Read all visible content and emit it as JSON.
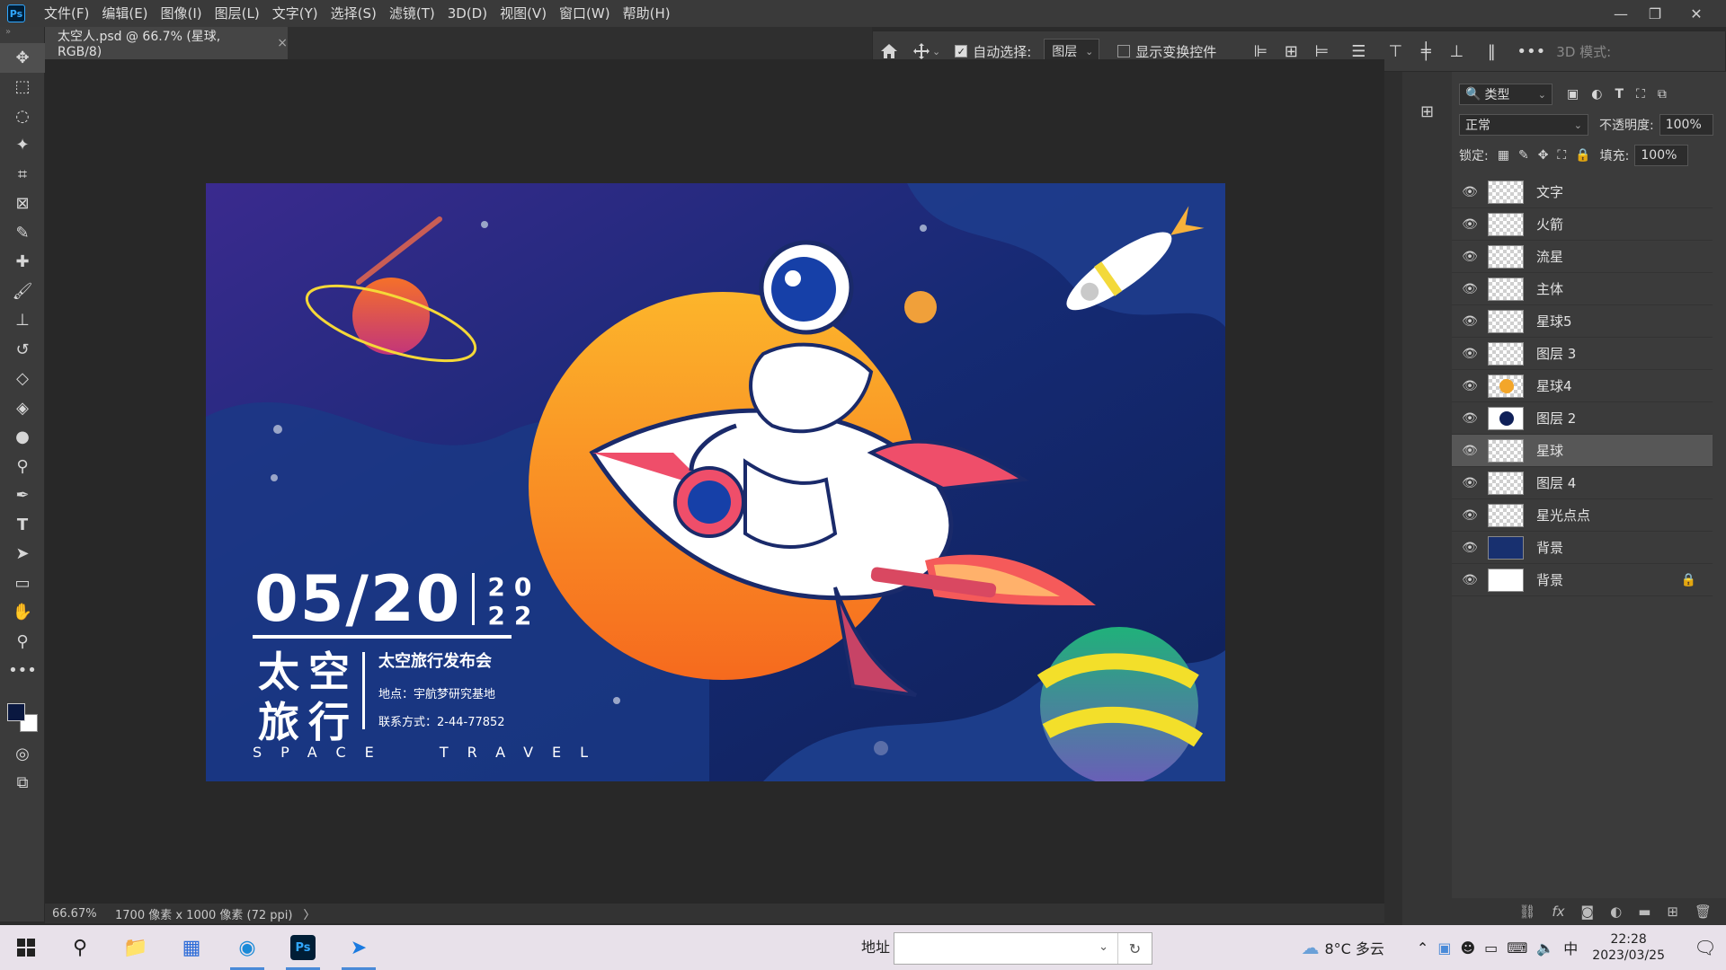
{
  "app": {
    "logo": "Ps"
  },
  "menu": [
    "文件(F)",
    "编辑(E)",
    "图像(I)",
    "图层(L)",
    "文字(Y)",
    "选择(S)",
    "滤镜(T)",
    "3D(D)",
    "视图(V)",
    "窗口(W)",
    "帮助(H)"
  ],
  "window_controls": {
    "minimize": "—",
    "restore": "❐",
    "close": "✕"
  },
  "document_tab": {
    "title": "太空人.psd @ 66.7% (星球, RGB/8)",
    "close": "×"
  },
  "options": {
    "auto_select_label": "自动选择:",
    "auto_select_value": "图层",
    "show_transform_label": "显示变换控件",
    "mode_3d_label": "3D 模式:"
  },
  "artwork": {
    "date": "05/20",
    "year_top": "20",
    "year_bottom": "22",
    "title_line1": "太空",
    "title_line2": "旅行",
    "event": "太空旅行发布会",
    "location": "地点：宇航梦研究基地",
    "contact": "联系方式：2-44-77852",
    "english": "SPACE  TRAVEL"
  },
  "status": {
    "zoom": "66.67%",
    "doc_size": "1700 像素 x 1000 像素 (72 ppi)",
    "arrow": "〉"
  },
  "layers_panel": {
    "filter_label": "类型",
    "blend_mode": "正常",
    "opacity_label": "不透明度:",
    "opacity_value": "100%",
    "lock_label": "锁定:",
    "fill_label": "填充:",
    "fill_value": "100%",
    "layers": [
      {
        "name": "文字",
        "selected": false
      },
      {
        "name": "火箭",
        "selected": false
      },
      {
        "name": "流星",
        "selected": false
      },
      {
        "name": "主体",
        "selected": false
      },
      {
        "name": "星球5",
        "selected": false
      },
      {
        "name": "图层 3",
        "selected": false
      },
      {
        "name": "星球4",
        "selected": false
      },
      {
        "name": "图层 2",
        "selected": false
      },
      {
        "name": "星球",
        "selected": true
      },
      {
        "name": "图层 4",
        "selected": false
      },
      {
        "name": "星光点点",
        "selected": false
      },
      {
        "name": "背景",
        "selected": false
      },
      {
        "name": "背景",
        "selected": false
      }
    ]
  },
  "taskbar": {
    "address_label": "地址",
    "weather": "8°C 多云",
    "ime": "中",
    "time": "22:28",
    "date": "2023/03/25"
  }
}
